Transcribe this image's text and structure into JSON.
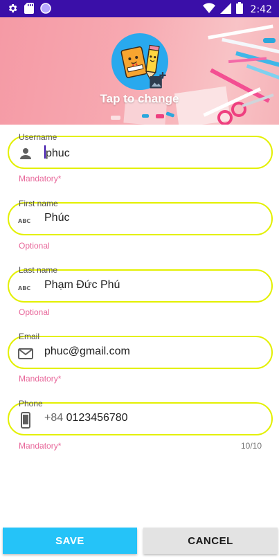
{
  "status_bar": {
    "time": "2:42",
    "left_icons": [
      "gear-icon",
      "sd-card-icon",
      "circle-icon"
    ],
    "right_icons": [
      "wifi-icon",
      "signal-icon",
      "battery-icon"
    ],
    "background": "#3a0fa8"
  },
  "header": {
    "avatar_hint": "Tap to change"
  },
  "form": {
    "username": {
      "label": "Username",
      "value": "phuc",
      "helper": "Mandatory*",
      "icon": "person-icon"
    },
    "first_name": {
      "label": "First name",
      "value": "Phúc",
      "helper": "Optional",
      "icon": "abc-icon"
    },
    "last_name": {
      "label": "Last name",
      "value": "Phạm Đức Phú",
      "helper": "Optional",
      "icon": "abc-icon"
    },
    "email": {
      "label": "Email",
      "value": "phuc@gmail.com",
      "helper": "Mandatory*",
      "icon": "mail-icon"
    },
    "phone": {
      "label": "Phone",
      "prefix": "+84",
      "value": "0123456780",
      "helper": "Mandatory*",
      "counter": "10/10",
      "icon": "phone-icon"
    }
  },
  "actions": {
    "save_label": "SAVE",
    "cancel_label": "CANCEL"
  },
  "colors": {
    "field_border": "#e3f000",
    "helper_text": "#e8679a",
    "save_button": "#25c3f8",
    "cancel_button": "#e3e3e3"
  }
}
